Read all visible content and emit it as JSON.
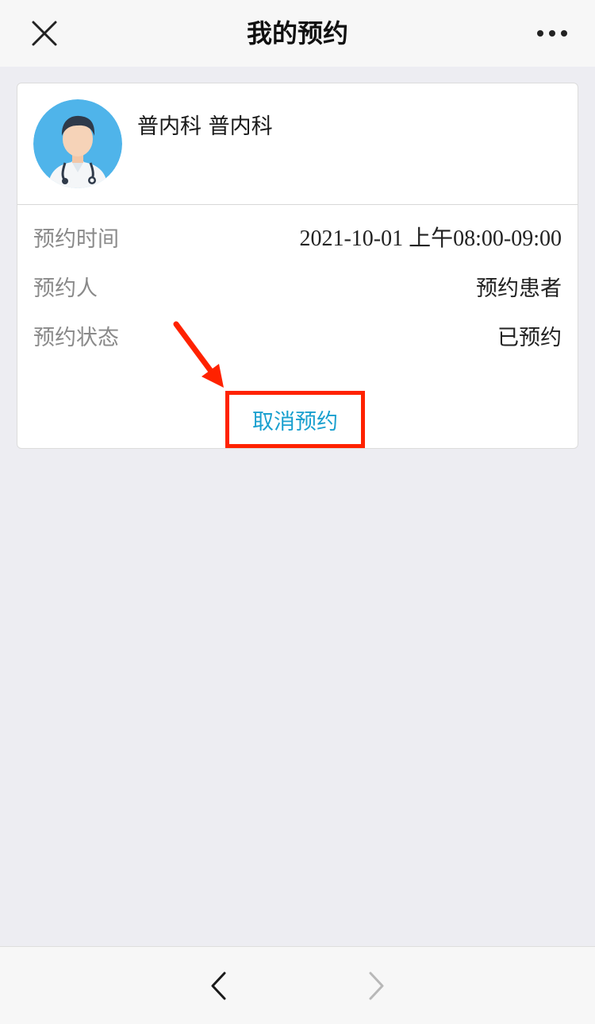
{
  "navbar": {
    "title": "我的预约",
    "close_icon": "close-icon",
    "more_icon": "more-icon"
  },
  "appointment": {
    "department": "普内科 普内科",
    "avatar_icon": "doctor-avatar-icon",
    "rows": [
      {
        "label": "预约时间",
        "value": "2021-10-01 上午08:00-09:00"
      },
      {
        "label": "预约人",
        "value": "预约患者"
      },
      {
        "label": "预约状态",
        "value": "已预约"
      }
    ],
    "cancel_label": "取消预约"
  },
  "toolbar": {
    "back_icon": "chevron-left-icon",
    "forward_icon": "chevron-right-icon"
  },
  "colors": {
    "accent": "#1aa0cf",
    "highlight": "#ff2200",
    "background": "#ededf2",
    "avatar_bg": "#4fb4ea"
  }
}
